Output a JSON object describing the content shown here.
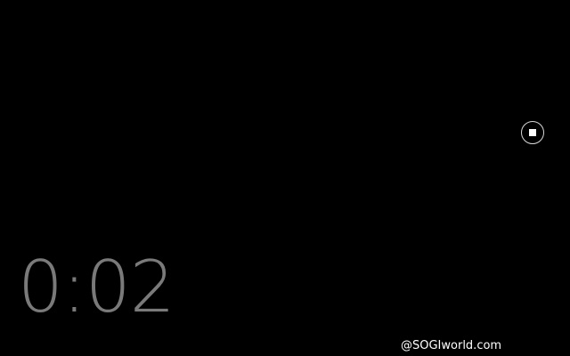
{
  "recording": {
    "elapsed": "0:02"
  },
  "watermark": {
    "text": "@SOGIworld.com"
  },
  "colors": {
    "background": "#000000",
    "timer_text": "#7a7a7a",
    "watermark_text": "#ffffff",
    "stop_ring": "#d8d8d8",
    "stop_square": "#ffffff"
  }
}
